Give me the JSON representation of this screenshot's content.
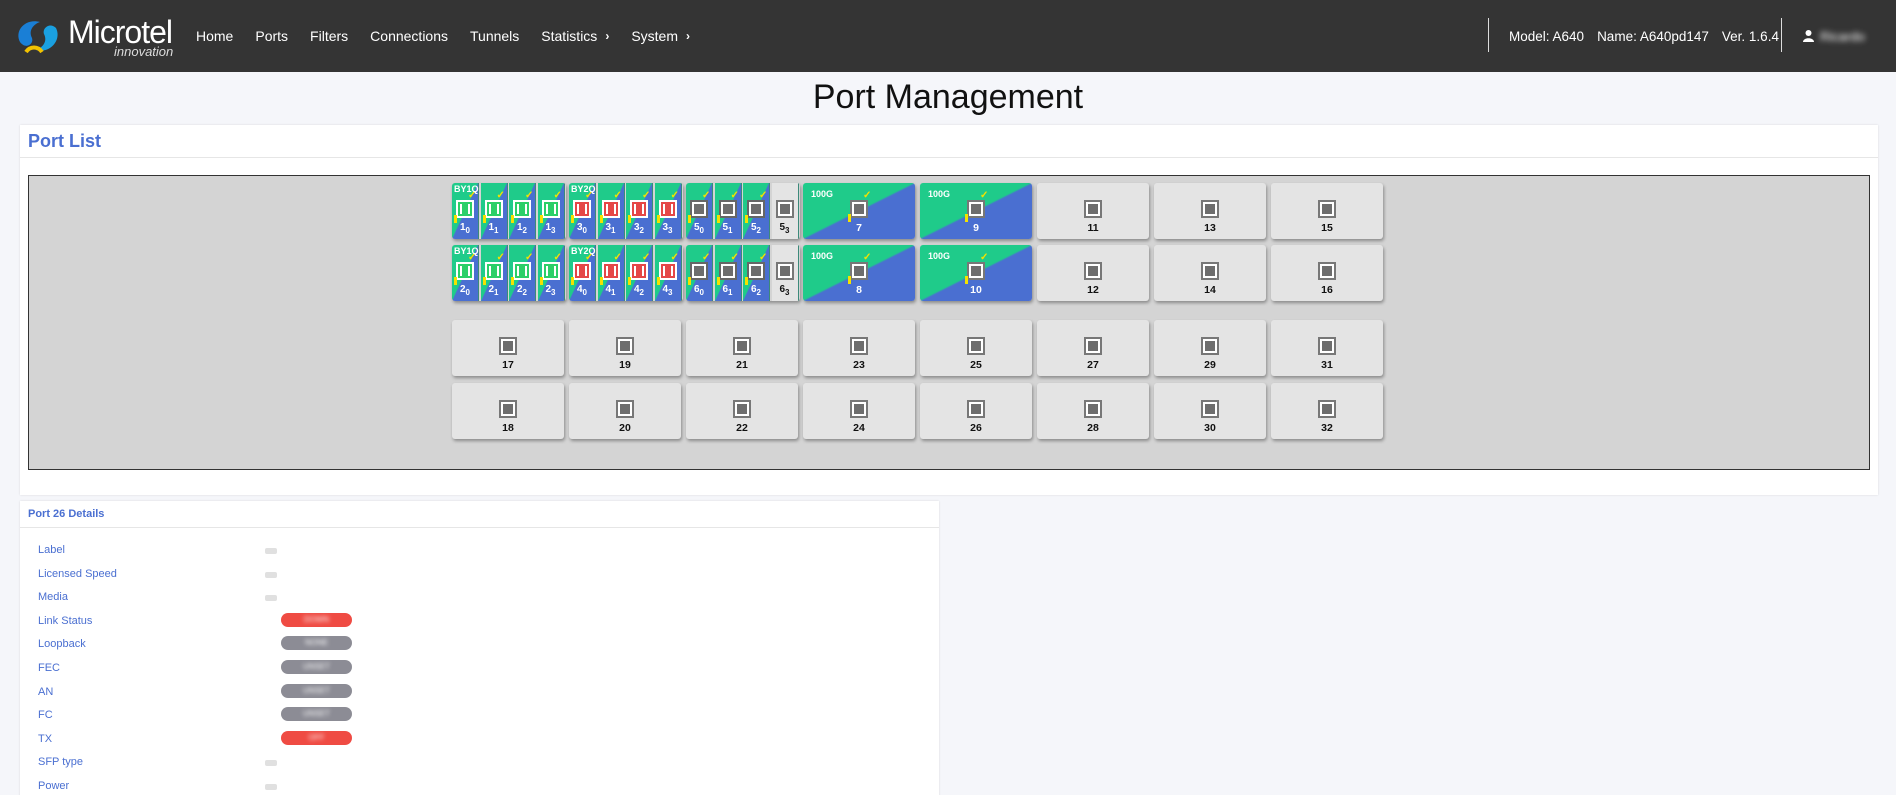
{
  "brand": {
    "name": "Microtel",
    "sub": "innovation"
  },
  "nav": {
    "items": [
      {
        "label": "Home"
      },
      {
        "label": "Ports"
      },
      {
        "label": "Filters"
      },
      {
        "label": "Connections"
      },
      {
        "label": "Tunnels"
      },
      {
        "label": "Statistics",
        "has_submenu": true
      },
      {
        "label": "System",
        "has_submenu": true
      }
    ],
    "model": "Model: A640",
    "name": "Name: A640pd147",
    "version": "Ver. 1.6.4",
    "user": "Ricardo"
  },
  "page_title": "Port Management",
  "port_list": {
    "title": "Port List",
    "groups": [
      {
        "label": "BY1Q",
        "subs": [
          [
            "1",
            "0"
          ],
          [
            "1",
            "1"
          ],
          [
            "1",
            "2"
          ],
          [
            "1",
            "3"
          ]
        ],
        "color": "green"
      },
      {
        "label": "BY2Q",
        "subs": [
          [
            "3",
            "0"
          ],
          [
            "3",
            "1"
          ],
          [
            "3",
            "2"
          ],
          [
            "3",
            "3"
          ]
        ],
        "color": "red"
      },
      {
        "label": "",
        "subs": [
          [
            "5",
            "0"
          ],
          [
            "5",
            "1"
          ],
          [
            "5",
            "2"
          ],
          [
            "5",
            "3"
          ]
        ],
        "color": "grey"
      },
      {
        "label": "BY1Q",
        "subs": [
          [
            "2",
            "0"
          ],
          [
            "2",
            "1"
          ],
          [
            "2",
            "2"
          ],
          [
            "2",
            "3"
          ]
        ],
        "color": "green"
      },
      {
        "label": "BY2Q",
        "subs": [
          [
            "4",
            "0"
          ],
          [
            "4",
            "1"
          ],
          [
            "4",
            "2"
          ],
          [
            "4",
            "3"
          ]
        ],
        "color": "red"
      },
      {
        "label": "",
        "subs": [
          [
            "6",
            "0"
          ],
          [
            "6",
            "1"
          ],
          [
            "6",
            "2"
          ],
          [
            "6",
            "3"
          ]
        ],
        "color": "grey"
      }
    ],
    "speed_ports": [
      {
        "num": "7",
        "speed": "100G"
      },
      {
        "num": "9",
        "speed": "100G"
      },
      {
        "num": "8",
        "speed": "100G"
      },
      {
        "num": "10",
        "speed": "100G"
      }
    ],
    "empty_ports_top": [
      "11",
      "13",
      "15",
      "12",
      "14",
      "16"
    ],
    "empty_ports_bottom": [
      "17",
      "19",
      "21",
      "23",
      "25",
      "27",
      "29",
      "31",
      "18",
      "20",
      "22",
      "24",
      "26",
      "28",
      "30",
      "32"
    ]
  },
  "details": {
    "title": "Port 26 Details",
    "rows": [
      {
        "label": "Label",
        "value": ""
      },
      {
        "label": "Licensed Speed",
        "value": ""
      },
      {
        "label": "Media",
        "value": ""
      },
      {
        "label": "Link Status",
        "badge": "DOWN",
        "badge_color": "red"
      },
      {
        "label": "Loopback",
        "badge": "NONE",
        "badge_color": "grey"
      },
      {
        "label": "FEC",
        "badge": "UNSET",
        "badge_color": "grey"
      },
      {
        "label": "AN",
        "badge": "UNSET",
        "badge_color": "grey"
      },
      {
        "label": "FC",
        "badge": "UNSET",
        "badge_color": "grey"
      },
      {
        "label": "TX",
        "badge": "OFF",
        "badge_color": "red"
      },
      {
        "label": "SFP type",
        "value": ""
      },
      {
        "label": "Power",
        "value": ""
      }
    ]
  },
  "colors": {
    "navbar": "#343434",
    "accent": "#4a6fd1",
    "port_green": "#1fcb8a",
    "port_blue": "#4a6fd1",
    "status_red": "#ef4b43",
    "status_grey": "#8c8c95"
  }
}
